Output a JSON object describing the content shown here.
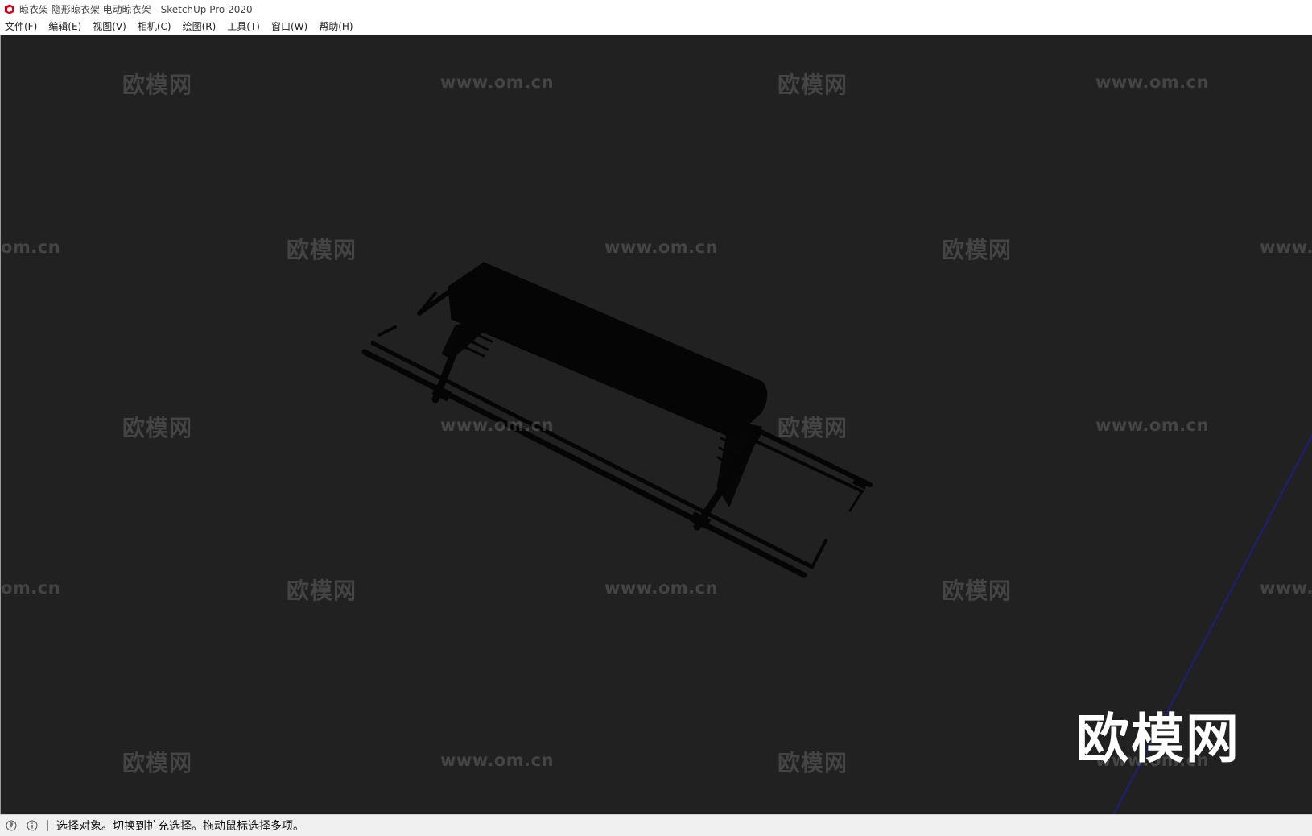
{
  "window": {
    "title": "晾衣架 隐形晾衣架 电动晾衣架 - SketchUp Pro 2020",
    "app_icon": "sketchup-logo-icon",
    "accent_color": "#d0021b"
  },
  "menubar": {
    "items": [
      {
        "label": "文件(F)"
      },
      {
        "label": "编辑(E)"
      },
      {
        "label": "视图(V)"
      },
      {
        "label": "相机(C)"
      },
      {
        "label": "绘图(R)"
      },
      {
        "label": "工具(T)"
      },
      {
        "label": "窗口(W)"
      },
      {
        "label": "帮助(H)"
      }
    ]
  },
  "viewport": {
    "background": "#212121",
    "axis_color": "#1f1f7a",
    "model_color": "#050505",
    "watermarks": {
      "brand": "欧模网",
      "url": "www.om.cn",
      "url_left_cut": "om.cn",
      "url_right_cut": "www."
    },
    "logo_big": "欧模网"
  },
  "statusbar": {
    "icons": [
      "geo-location-icon",
      "info-icon"
    ],
    "message": "选择对象。切换到扩充选择。拖动鼠标选择多项。"
  }
}
